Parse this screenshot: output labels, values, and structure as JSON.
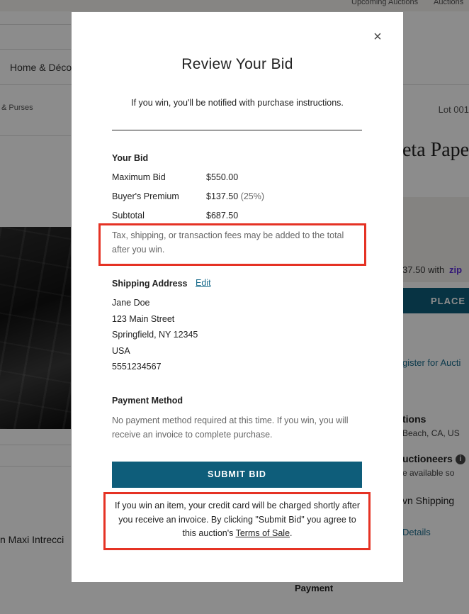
{
  "background": {
    "top_links": [
      "Upcoming Auctions",
      "Auctions"
    ],
    "nav_home": "Home & Décor",
    "breadcrumb_tail": "& Purses",
    "lot": "Lot 001",
    "item_title_left": "n Maxi Intrecci",
    "item_title_right": "eta Pape",
    "promo_text": "37.50 with",
    "promo_brand": "zip",
    "place_bid": "PLACE B",
    "register_link": "gister for Aucti",
    "locations_heading": "tions",
    "locations_value": "Beach, CA, US",
    "auctioneers_heading": "uctioneers",
    "info_icon": "i",
    "auctioneers_value": "e available so",
    "shipping_heading": "vn Shipping",
    "details_link": "Details",
    "payment_heading": "Payment"
  },
  "modal": {
    "close_label": "×",
    "title": "Review Your Bid",
    "intro": "If you win, you'll be notified with purchase instructions.",
    "your_bid": {
      "heading": "Your Bid",
      "rows": [
        {
          "label": "Maximum Bid",
          "value": "$550.00",
          "extra": ""
        },
        {
          "label": "Buyer's Premium",
          "value": "$137.50",
          "extra": "(25%)"
        },
        {
          "label": "Subtotal",
          "value": "$687.50",
          "extra": ""
        }
      ],
      "fees_note": "Tax, shipping, or transaction fees may be added to the total after you win."
    },
    "shipping": {
      "heading": "Shipping Address",
      "edit_label": "Edit",
      "lines": [
        "Jane Doe",
        "123 Main Street",
        "Springfield, NY 12345",
        "USA",
        "5551234567"
      ]
    },
    "payment": {
      "heading": "Payment Method",
      "note": "No payment method required at this time. If you win, you will receive an invoice to complete purchase."
    },
    "submit_label": "SUBMIT BID",
    "legal": {
      "before": "If you win an item, your credit card will be charged shortly after you receive an invoice. By clicking \"Submit Bid\" you agree to this auction's ",
      "link": "Terms of Sale",
      "after": "."
    }
  },
  "colors": {
    "accent": "#0e5d7a",
    "link": "#1a6c8c",
    "highlight": "#e53224"
  }
}
